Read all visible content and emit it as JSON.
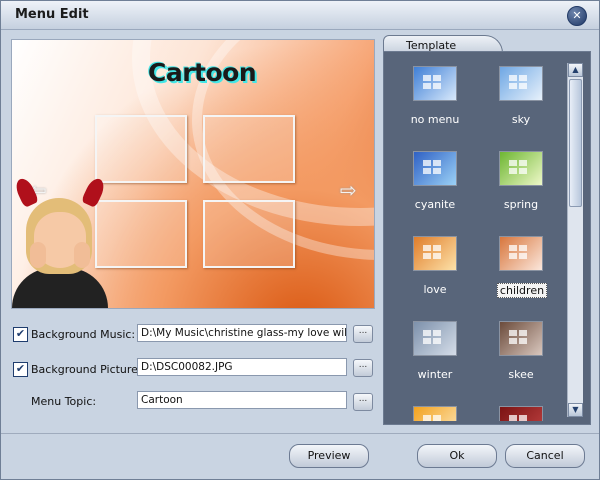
{
  "window": {
    "title": "Menu Edit"
  },
  "preview": {
    "title": "Cartoon",
    "left_arrow": "⇦",
    "right_arrow": "⇨"
  },
  "form": {
    "background_music": {
      "label": "Background Music:",
      "checked": true,
      "value": "D:\\My Music\\christine glass-my love will get"
    },
    "background_picture": {
      "label": "Background Picture:",
      "checked": true,
      "value": "D:\\DSC00082.JPG"
    },
    "menu_topic": {
      "label": "Menu Topic:",
      "value": "Cartoon"
    },
    "browse_label": "..."
  },
  "template_panel": {
    "tab_label": "Template",
    "items": [
      {
        "name": "no menu",
        "colors": [
          "#3f7fd6",
          "#d8e9fb"
        ]
      },
      {
        "name": "sky",
        "colors": [
          "#6fa7e4",
          "#e7f1fb"
        ]
      },
      {
        "name": "cyanite",
        "colors": [
          "#2f61c4",
          "#9bd1f6"
        ]
      },
      {
        "name": "spring",
        "colors": [
          "#6eb632",
          "#eef8c8"
        ]
      },
      {
        "name": "love",
        "colors": [
          "#e07d2a",
          "#fde2a9"
        ]
      },
      {
        "name": "children",
        "colors": [
          "#d8763c",
          "#fbe7dc"
        ],
        "selected": true
      },
      {
        "name": "winter",
        "colors": [
          "#7d91ab",
          "#d5dde9"
        ]
      },
      {
        "name": "skee",
        "colors": [
          "#6b4b3b",
          "#d9c7be"
        ]
      },
      {
        "name": "",
        "colors": [
          "#f3a21e",
          "#fde9bf"
        ]
      },
      {
        "name": "",
        "colors": [
          "#7b1313",
          "#c24444"
        ]
      }
    ]
  },
  "buttons": {
    "preview": "Preview",
    "ok": "Ok",
    "cancel": "Cancel"
  },
  "icons": {
    "close": "close-icon",
    "check": "✔",
    "scroll_up": "▲",
    "scroll_down": "▼"
  }
}
